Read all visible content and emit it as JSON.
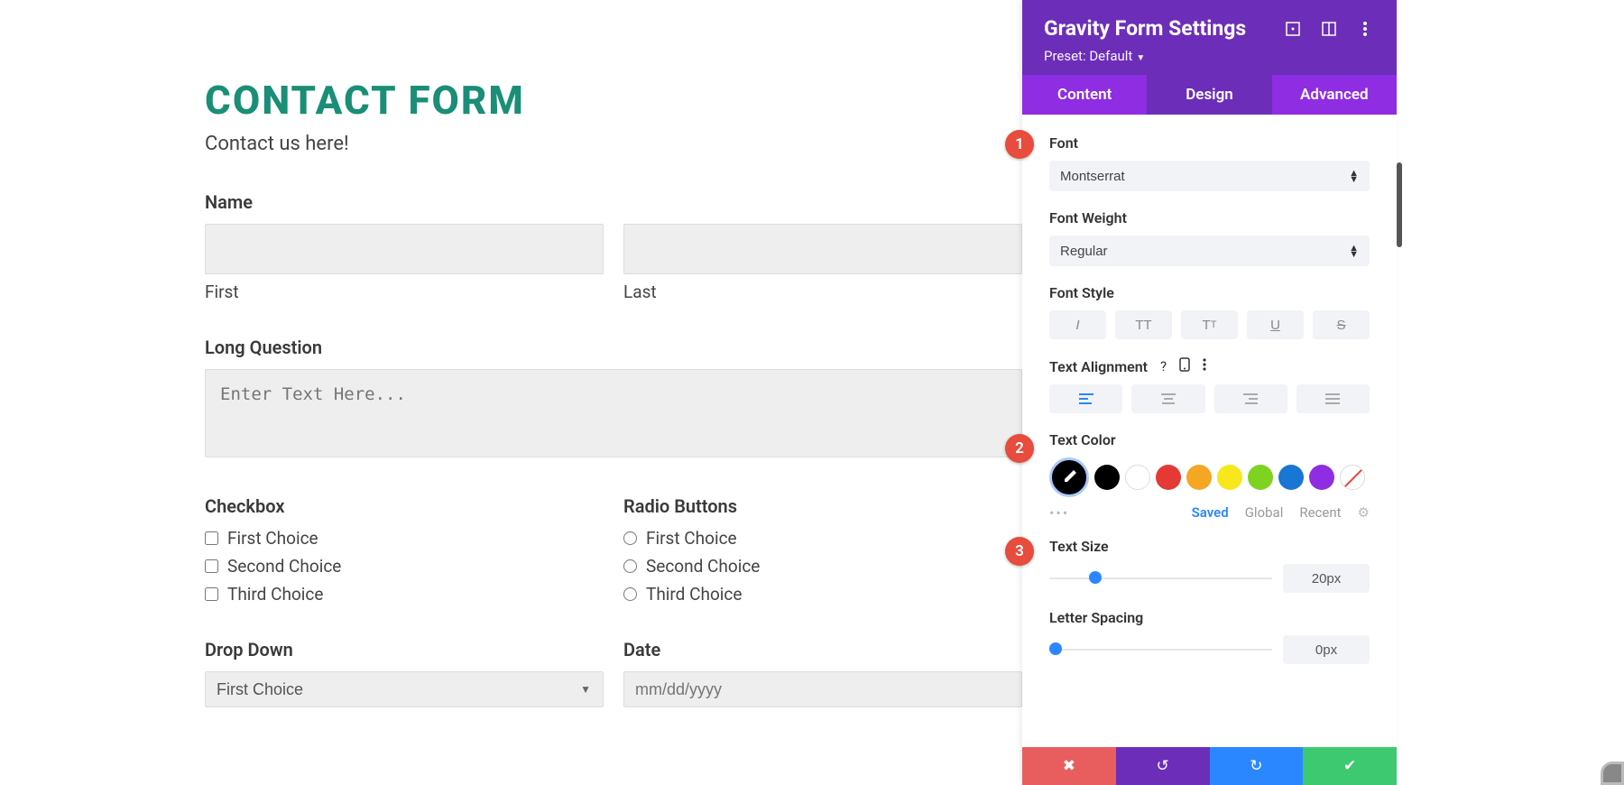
{
  "form": {
    "title": "CONTACT FORM",
    "description": "Contact us here!",
    "name_label": "Name",
    "first_label": "First",
    "last_label": "Last",
    "long_q_label": "Long Question",
    "long_q_placeholder": "Enter Text Here...",
    "checkbox_label": "Checkbox",
    "radio_label": "Radio Buttons",
    "choices": [
      "First Choice",
      "Second Choice",
      "Third Choice"
    ],
    "dropdown_label": "Drop Down",
    "dropdown_value": "First Choice",
    "date_label": "Date",
    "date_placeholder": "mm/dd/yyyy"
  },
  "panel": {
    "title": "Gravity Form Settings",
    "preset_label": "Preset: Default",
    "tabs": {
      "content": "Content",
      "design": "Design",
      "advanced": "Advanced"
    },
    "font_label": "Font",
    "font_value": "Montserrat",
    "weight_label": "Font Weight",
    "weight_value": "Regular",
    "style_label": "Font Style",
    "align_label": "Text Alignment",
    "color_label": "Text Color",
    "color_tabs": {
      "saved": "Saved",
      "global": "Global",
      "recent": "Recent"
    },
    "swatches": [
      "#000000",
      "#ffffff",
      "#e53935",
      "#f5a623",
      "#f8e71c",
      "#7ed321",
      "#1976d2",
      "#8e2de2"
    ],
    "size_label": "Text Size",
    "size_value": "20px",
    "size_pos_pct": 18,
    "spacing_label": "Letter Spacing",
    "spacing_value": "0px",
    "spacing_pos_pct": 0
  },
  "badges": {
    "b1": "1",
    "b2": "2",
    "b3": "3"
  }
}
